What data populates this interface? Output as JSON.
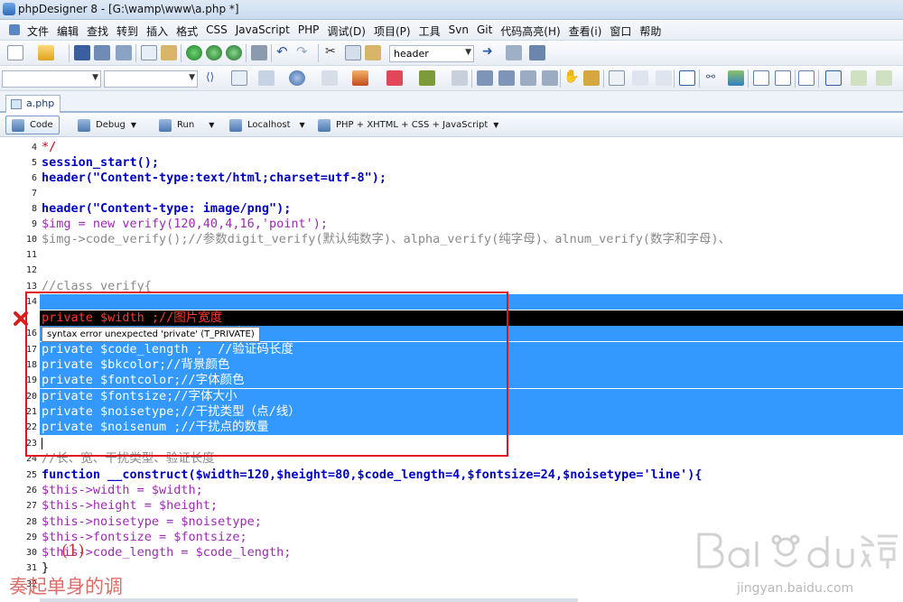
{
  "window": {
    "title": "phpDesigner 8 - [G:\\wamp\\www\\a.php *]"
  },
  "menubar": {
    "items": [
      "文件",
      "编辑",
      "查找",
      "转到",
      "插入",
      "格式",
      "CSS",
      "JavaScript",
      "PHP",
      "调试(D)",
      "项目(P)",
      "工具",
      "Svn",
      "Git",
      "代码高亮(H)",
      "查看(i)",
      "窗口",
      "帮助"
    ]
  },
  "toolbar": {
    "search_combo": "header"
  },
  "tabs": [
    {
      "label": "a.php"
    }
  ],
  "modebar": {
    "code": "Code",
    "debug": "Debug",
    "run": "Run",
    "localhost": "Localhost",
    "syntax": "PHP + XHTML + CSS + JavaScript"
  },
  "editor": {
    "lines": [
      {
        "n": "4",
        "text": "*/"
      },
      {
        "n": "5",
        "text": "session_start();"
      },
      {
        "n": "6",
        "text": "header(\"Content-type:text/html;charset=utf-8\");"
      },
      {
        "n": "7",
        "text": ""
      },
      {
        "n": "8",
        "text": "header(\"Content-type: image/png\");"
      },
      {
        "n": "9",
        "text": "$img = new verify(120,40,4,16,'point');"
      },
      {
        "n": "10",
        "text": "$img->code_verify();//参数digit_verify(默认纯数字)、alpha_verify(纯字母)、alnum_verify(数字和字母)、"
      },
      {
        "n": "11",
        "text": ""
      },
      {
        "n": "12",
        "text": ""
      },
      {
        "n": "13",
        "text": "//class verify{"
      },
      {
        "n": "14",
        "text": ""
      },
      {
        "n": "15",
        "text": "private $width ;//图片宽度"
      },
      {
        "n": "16",
        "text": "度"
      },
      {
        "n": "17",
        "text": "private $code_length ;  //验证码长度"
      },
      {
        "n": "18",
        "text": "private $bkcolor;//背景颜色"
      },
      {
        "n": "19",
        "text": "private $fontcolor;//字体颜色"
      },
      {
        "n": "20",
        "text": "private $fontsize;//字体大小"
      },
      {
        "n": "21",
        "text": "private $noisetype;//干扰类型（点/线）"
      },
      {
        "n": "22",
        "text": "private $noisenum ;//干扰点的数量"
      },
      {
        "n": "23",
        "text": ""
      },
      {
        "n": "24",
        "text": "//长、宽、干扰类型、验证长度"
      },
      {
        "n": "25",
        "text": "function __construct($width=120,$height=80,$code_length=4,$fontsize=24,$noisetype='line'){"
      },
      {
        "n": "26",
        "text": "$this->width = $width;"
      },
      {
        "n": "27",
        "text": "$this->height = $height;"
      },
      {
        "n": "28",
        "text": "$this->noisetype = $noisetype;"
      },
      {
        "n": "29",
        "text": "$this->fontsize = $fontsize;"
      },
      {
        "n": "30",
        "text": "$this->code_length = $code_length;"
      },
      {
        "n": "31",
        "text": "}"
      },
      {
        "n": "32",
        "text": ""
      }
    ],
    "error_tooltip": "syntax error unexpected 'private' (T_PRIVATE)"
  },
  "annotations": {
    "mark": "(1)",
    "watermark_text": "奏起单身的调",
    "baidu_url": "jingyan.baidu.com"
  },
  "colors": {
    "selection": "#3399ff",
    "keyword": "#0000c8",
    "variable": "#9c2bb1",
    "string": "#c8001e",
    "annotation": "#e0141e"
  }
}
